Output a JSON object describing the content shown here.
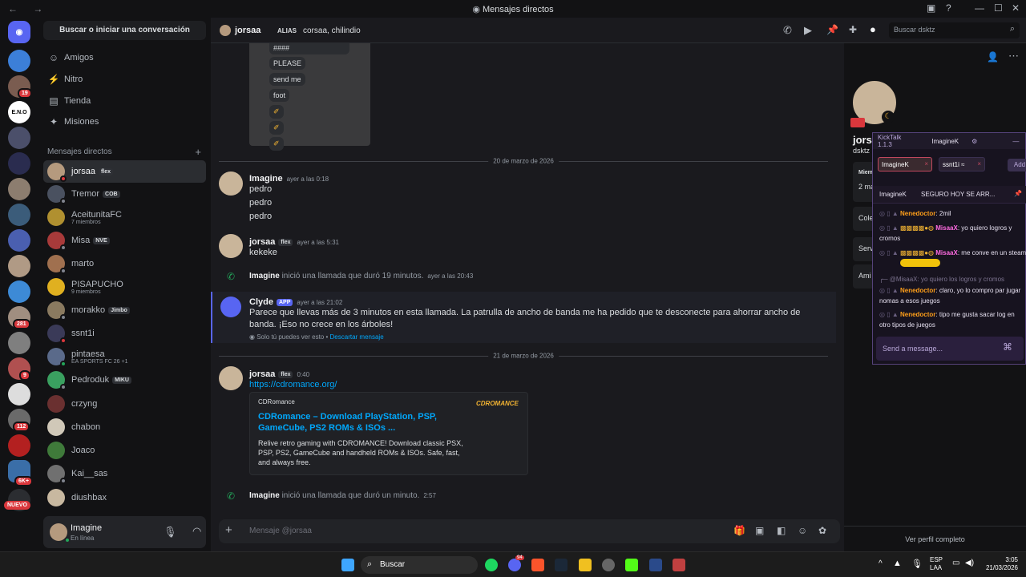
{
  "window": {
    "title": "Mensajes directos",
    "nav": "← →"
  },
  "sidebar": {
    "search_button": "Buscar o iniciar una conversación",
    "nav": [
      {
        "label": "Amigos",
        "icon": "friends-icon"
      },
      {
        "label": "Nitro",
        "icon": "nitro-icon"
      },
      {
        "label": "Tienda",
        "icon": "shop-icon"
      },
      {
        "label": "Misiones",
        "icon": "quests-icon"
      }
    ],
    "dm_section": "Mensajes directos",
    "dms": [
      {
        "name": "jorsaa",
        "tag": "flex",
        "sub": ""
      },
      {
        "name": "Tremor",
        "tag": "COB",
        "sub": ""
      },
      {
        "name": "AceitunitaFC",
        "tag": "",
        "sub": "7 miembros"
      },
      {
        "name": "Misa",
        "tag": "NVE",
        "sub": ""
      },
      {
        "name": "marto",
        "tag": "",
        "sub": ""
      },
      {
        "name": "PISAPUCHO",
        "tag": "",
        "sub": "9 miembros"
      },
      {
        "name": "morakko",
        "tag": "Jimbo",
        "sub": ""
      },
      {
        "name": "ssnt1i",
        "tag": "",
        "sub": ""
      },
      {
        "name": "pintaesa",
        "tag": "",
        "sub": "EA SPORTS FC 26 +1"
      },
      {
        "name": "Pedroduk",
        "tag": "MIKU",
        "sub": ""
      },
      {
        "name": "crzyng",
        "tag": "",
        "sub": ""
      },
      {
        "name": "chabon",
        "tag": "",
        "sub": ""
      },
      {
        "name": "Joaco",
        "tag": "",
        "sub": ""
      },
      {
        "name": "Kai__sas",
        "tag": "",
        "sub": ""
      },
      {
        "name": "diushbax",
        "tag": "",
        "sub": ""
      }
    ],
    "user": {
      "name": "Imagine",
      "status": "En línea"
    }
  },
  "servers": {
    "badges": [
      "19",
      "281",
      "9",
      "112",
      "6K+"
    ],
    "new_label": "NUEVO",
    "eno_label": "E.N.O"
  },
  "topbar": {
    "channel": "jorsaa",
    "alias_label": "ALIAS",
    "alias_value": "corsaa, chilindio",
    "search_placeholder": "Buscar dsktz"
  },
  "chat": {
    "bubbles": [
      "####",
      "PLEASE",
      "send me",
      "foot"
    ],
    "day1": "20 de marzo de 2026",
    "day2": "21 de marzo de 2026",
    "m1": {
      "author": "Imagine",
      "time": "ayer a las 0:18",
      "lines": [
        "pedro",
        "pedro",
        "pedro"
      ]
    },
    "m2": {
      "author": "jorsaa",
      "tag": "flex",
      "time": "ayer a las 5:31",
      "text": "kekeke"
    },
    "call1": {
      "author": "Imagine",
      "text": "inició una llamada que duró 19 minutos.",
      "time": "ayer a las 20:43"
    },
    "clyde": {
      "author": "Clyde",
      "tag": "APP",
      "time": "ayer a las 21:02",
      "text": "Parece que llevas más de 3 minutos en esta llamada. La patrulla de ancho de banda me ha pedido que te desconecte para ahorrar ancho de banda. ¡Eso no crece en los árboles!",
      "note": "Solo tú puedes ver esto •",
      "dismiss": "Descartar mensaje"
    },
    "m3": {
      "author": "jorsaa",
      "tag": "flex",
      "time": "0:40",
      "link": "https://cdromance.org/",
      "embed": {
        "site": "CDRomance",
        "title": "CDRomance – Download PlayStation, PSP, GameCube, PS2 ROMs & ISOs ...",
        "desc": "Relive retro gaming with CDROMANCE! Download classic PSX, PSP, PS2, GameCube and handheld ROMs & ISOs. Safe, fast, and always free.",
        "logo": "CDROMANCE"
      }
    },
    "call2": {
      "author": "Imagine",
      "text": "inició una llamada que duró un minuto.",
      "time": "2:57"
    }
  },
  "composer": {
    "placeholder": "Mensaje @jorsaa"
  },
  "right": {
    "name": "jorsa",
    "sub": "dsktz",
    "mie": "Miem",
    "two": "2 ma",
    "col": "Cole",
    "ser": "Serv",
    "ami": "Ami",
    "view_profile": "Ver perfil completo"
  },
  "kicktalk": {
    "title": "KickTalk 1.1.3",
    "tab1": "ImagineK",
    "chip1": "ImagineK",
    "chip2": "ssnt1i",
    "chip2_extra": "≈",
    "add": "Add",
    "pinned_user": "ImagineK",
    "pinned_text": "SEGURO HOY SE ARR...",
    "lines": [
      {
        "user": "Nenedoctor",
        "text": "2mil",
        "pink": false
      },
      {
        "user": "MisaaX",
        "text": "yo quiero logros y cromos",
        "pink": true
      },
      {
        "user": "MisaaX",
        "text": "me conve en un        steam",
        "pink": true
      },
      {
        "user": "@MisaaX:",
        "text": "yo quiero los logros y cromos",
        "pink": false,
        "reply": true
      },
      {
        "user": "Nenedoctor",
        "text": "claro, yo lo compro par jugar nomas a esos juegos",
        "pink": false
      },
      {
        "user": "Nenedoctor",
        "text": "tipo me gusta sacar log en otro tipos de juegos",
        "pink": false
      }
    ],
    "input_placeholder": "Send a message..."
  },
  "taskbar": {
    "search": "Buscar",
    "lang1": "ESP",
    "lang2": "LAA",
    "time": "3:05",
    "date": "21/03/2026",
    "discord_badge": "94"
  }
}
